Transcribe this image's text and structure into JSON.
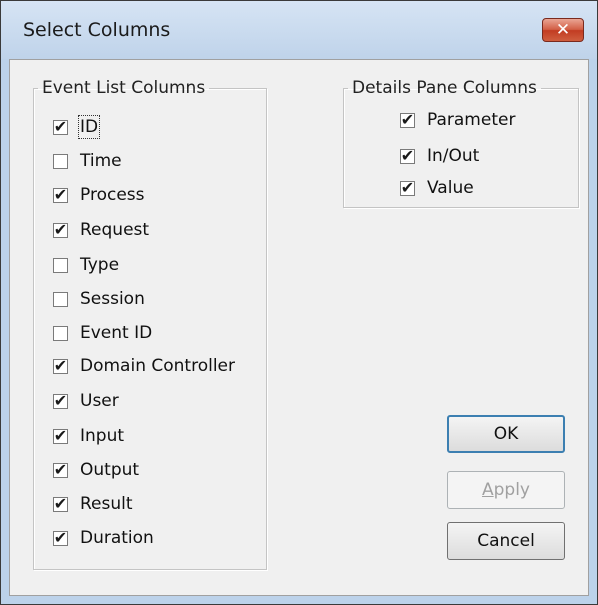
{
  "dialog": {
    "title": "Select Columns",
    "close_glyph": "✕"
  },
  "event_list": {
    "legend": "Event List Columns",
    "items": [
      {
        "label": "ID",
        "checked": true,
        "focused": true
      },
      {
        "label": "Time",
        "checked": false
      },
      {
        "label": "Process",
        "checked": true
      },
      {
        "label": "Request",
        "checked": true
      },
      {
        "label": "Type",
        "checked": false
      },
      {
        "label": "Session",
        "checked": false
      },
      {
        "label": "Event ID",
        "checked": false
      },
      {
        "label": "Domain Controller",
        "checked": true
      },
      {
        "label": "User",
        "checked": true
      },
      {
        "label": "Input",
        "checked": true
      },
      {
        "label": "Output",
        "checked": true
      },
      {
        "label": "Result",
        "checked": true
      },
      {
        "label": "Duration",
        "checked": true
      }
    ]
  },
  "details_pane": {
    "legend": "Details Pane Columns",
    "items": [
      {
        "label": "Parameter",
        "checked": true
      },
      {
        "label": "In/Out",
        "checked": true
      },
      {
        "label": "Value",
        "checked": true
      }
    ]
  },
  "buttons": {
    "ok": "OK",
    "apply_accel": "A",
    "apply_rest": "pply",
    "cancel": "Cancel"
  },
  "check_glyph": "✔"
}
